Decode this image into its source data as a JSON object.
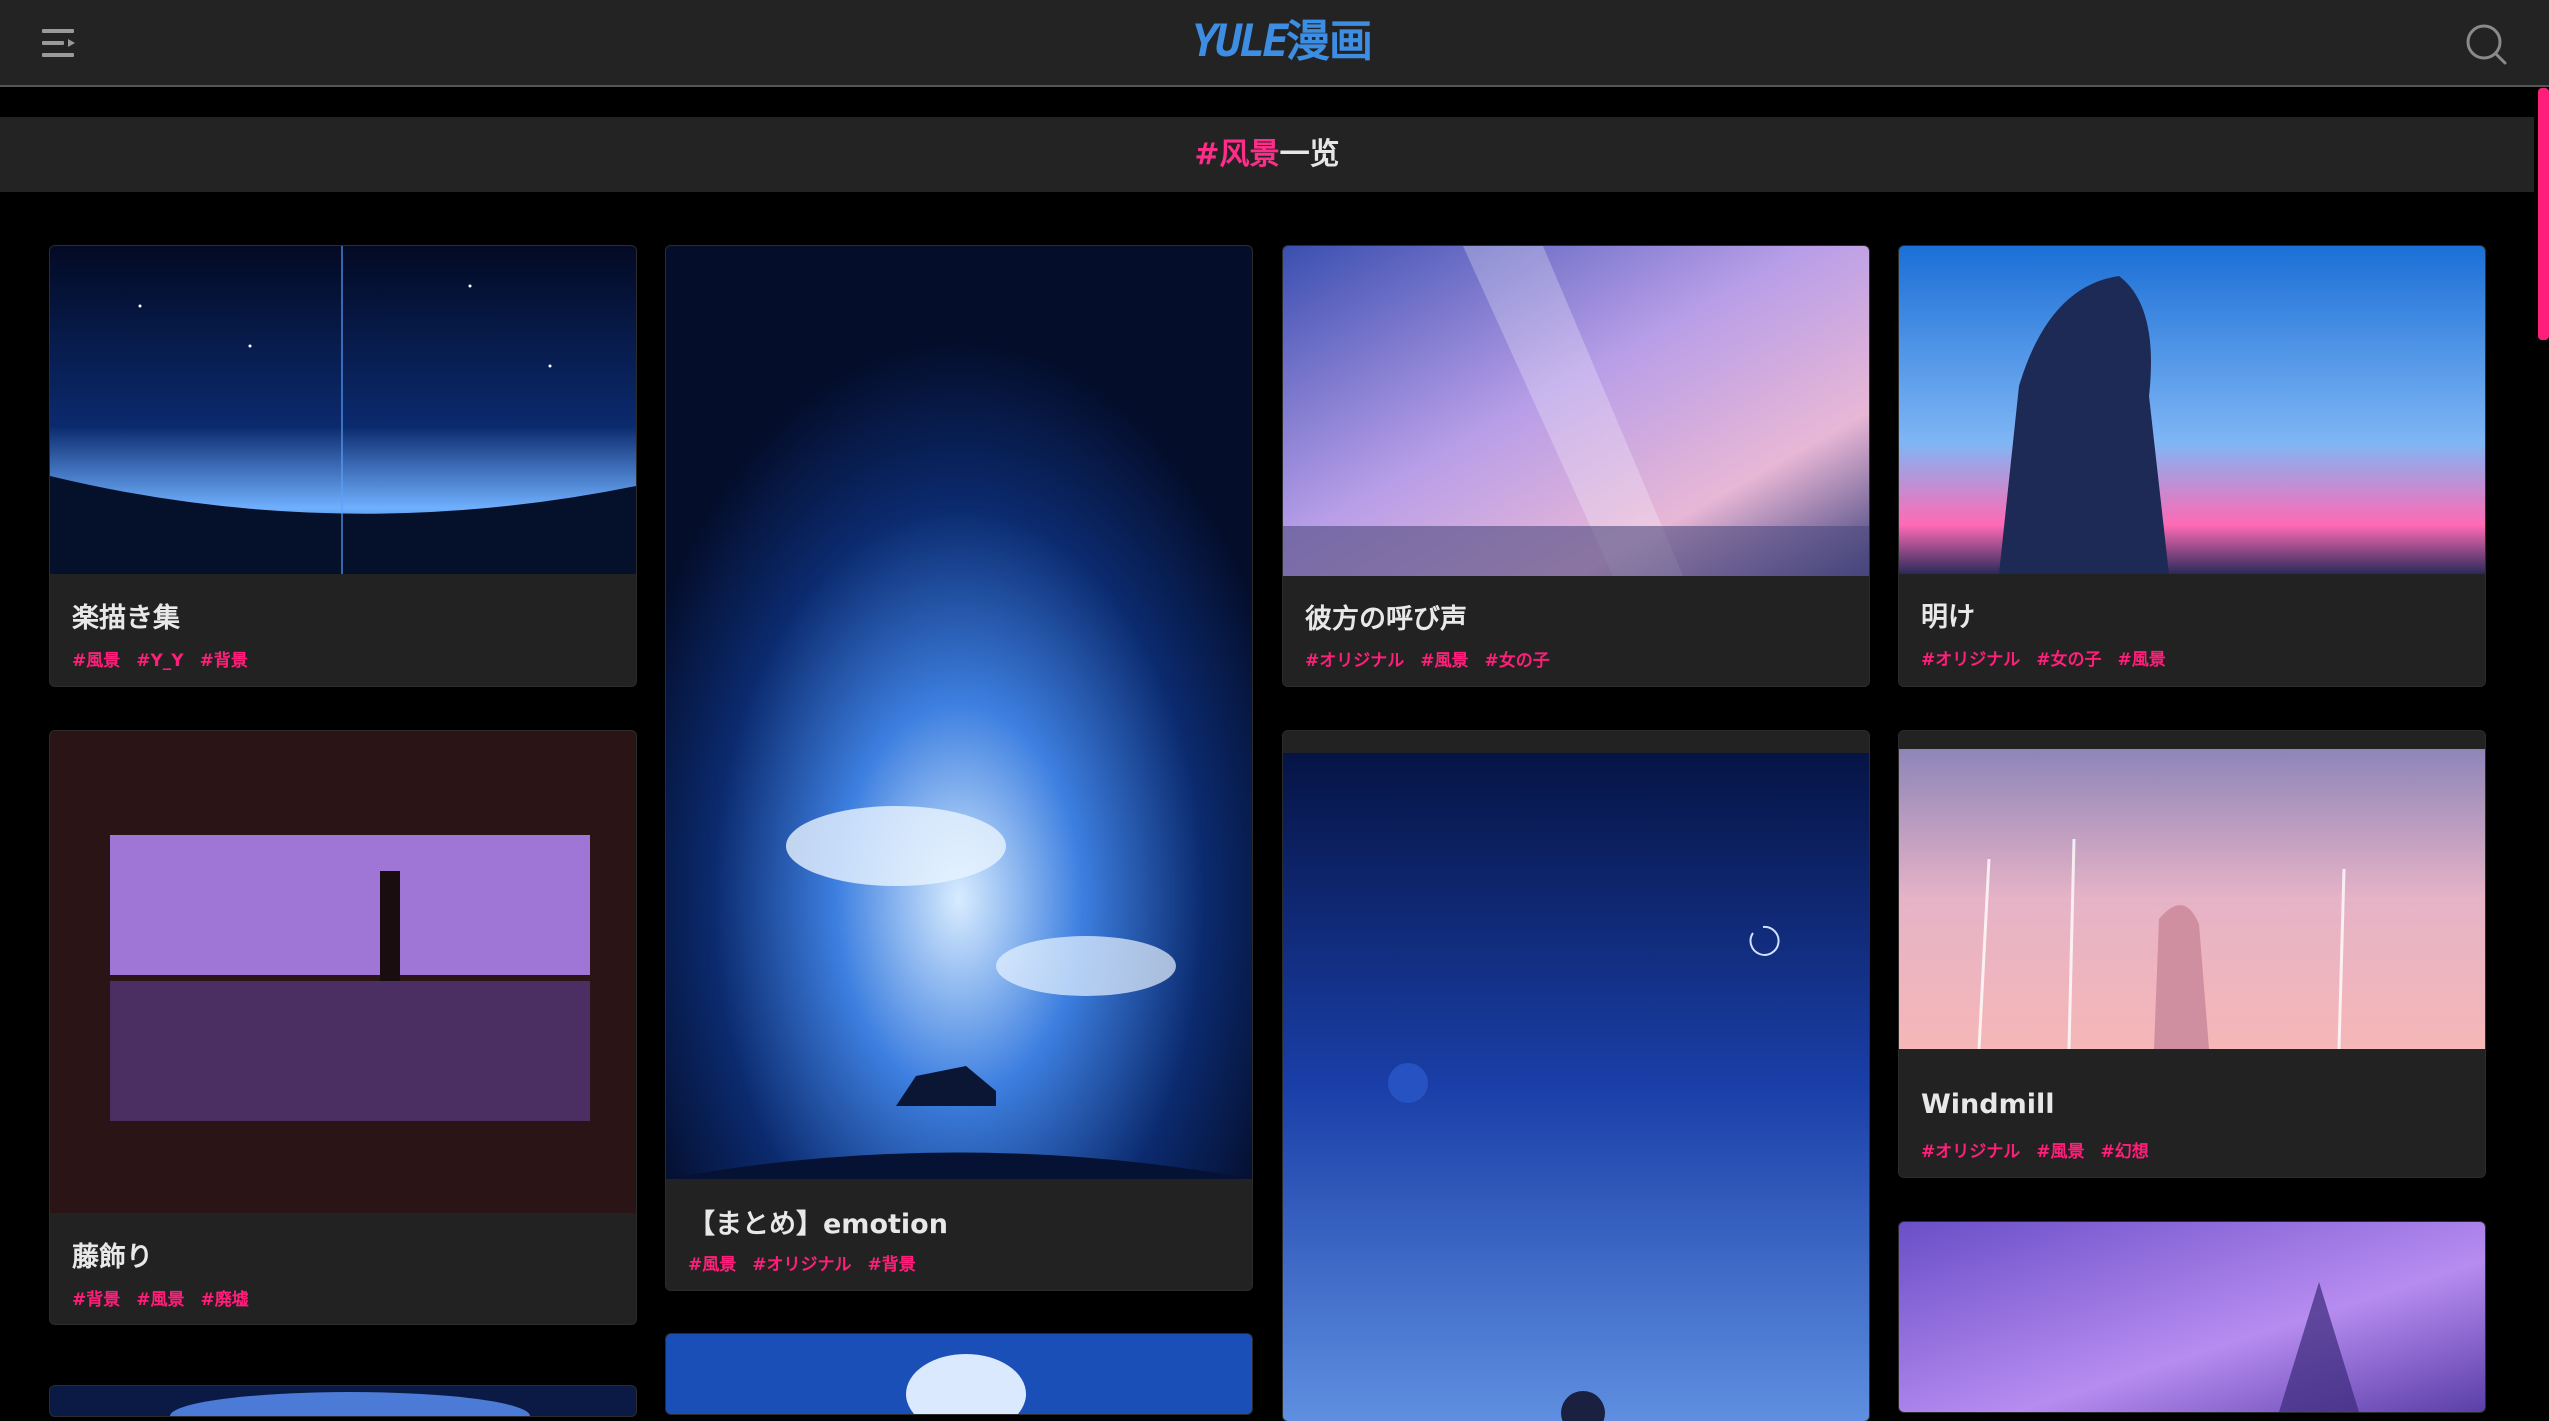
{
  "header": {
    "logo_latin": "YULE",
    "logo_cjk": "漫画"
  },
  "page": {
    "tag": "#风景",
    "suffix": "一览"
  },
  "cards": [
    {
      "title": "楽描き集",
      "tags": [
        "#風景",
        "#Y_Y",
        "#背景"
      ]
    },
    {
      "title": "藤飾り",
      "tags": [
        "#背景",
        "#風景",
        "#廃墟"
      ]
    },
    {
      "title": "【まとめ】emotion",
      "tags": [
        "#風景",
        "#オリジナル",
        "#背景"
      ]
    },
    {
      "title": "彼方の呼び声",
      "tags": [
        "#オリジナル",
        "#風景",
        "#女の子"
      ]
    },
    {
      "title": "明け",
      "tags": [
        "#オリジナル",
        "#女の子",
        "#風景"
      ]
    },
    {
      "title": "Windmill",
      "tags": [
        "#オリジナル",
        "#風景",
        "#幻想"
      ]
    }
  ],
  "colors": {
    "accent": "#ff1f7a",
    "logo": "#3d8de3",
    "bar": "#232323",
    "card": "#222222"
  }
}
